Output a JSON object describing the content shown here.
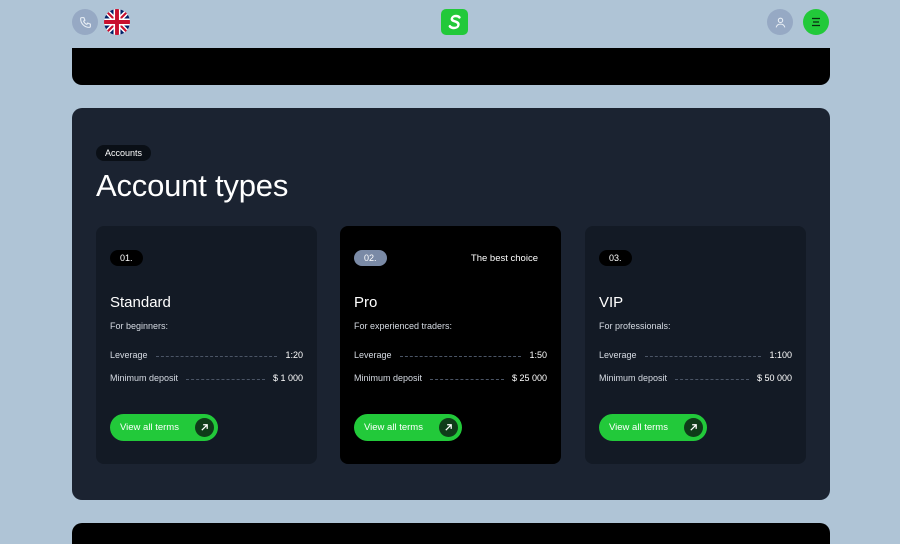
{
  "header": {
    "phone_icon": "phone-icon",
    "language_icon": "uk-flag-icon",
    "logo_icon": "logo-s-icon",
    "user_icon": "user-icon",
    "menu_icon": "hamburger-menu-icon"
  },
  "section": {
    "chip": "Accounts",
    "title": "Account types"
  },
  "cards": [
    {
      "num": "01.",
      "name": "Standard",
      "sub": "For beginners:",
      "badge": "",
      "rows": [
        {
          "label": "Leverage",
          "value": "1:20"
        },
        {
          "label": "Minimum deposit",
          "value": "$ 1 000"
        }
      ],
      "button": "View all terms"
    },
    {
      "num": "02.",
      "name": "Pro",
      "sub": "For experienced traders:",
      "badge": "The best choice",
      "rows": [
        {
          "label": "Leverage",
          "value": "1:50"
        },
        {
          "label": "Minimum deposit",
          "value": "$ 25 000"
        }
      ],
      "button": "View all terms"
    },
    {
      "num": "03.",
      "name": "VIP",
      "sub": "For professionals:",
      "badge": "",
      "rows": [
        {
          "label": "Leverage",
          "value": "1:100"
        },
        {
          "label": "Minimum deposit",
          "value": "$ 50 000"
        }
      ],
      "button": "View all terms"
    }
  ],
  "colors": {
    "accent": "#22c93a",
    "background": "#afc4d6",
    "panel": "#1b2331"
  }
}
